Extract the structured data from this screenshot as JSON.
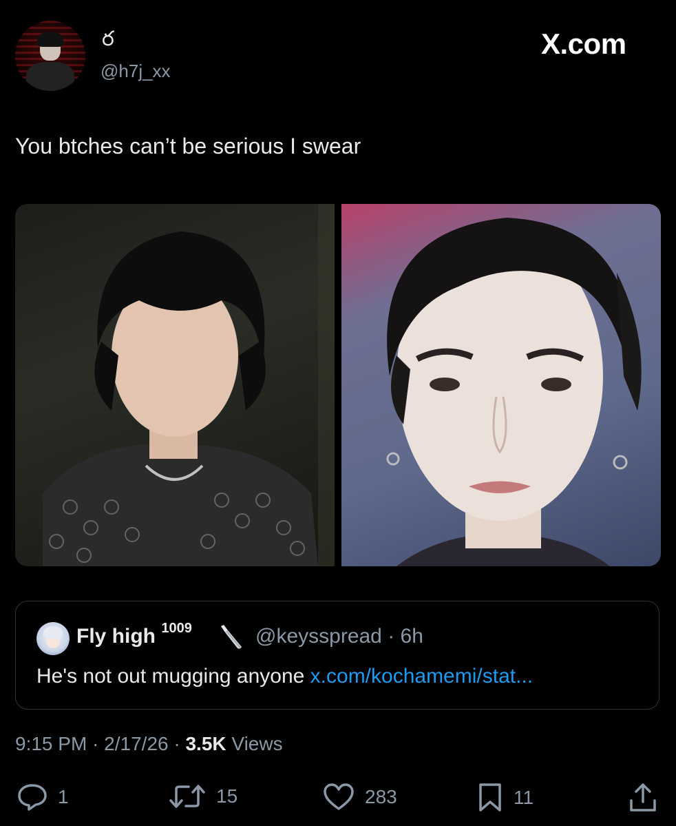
{
  "author": {
    "display_name": "ర",
    "handle": "@h7j_xx"
  },
  "brand": "X.com",
  "tweet": {
    "text": "You btches can’t be serious I swear"
  },
  "quote": {
    "name": "Fly high",
    "name_suffix": "1009",
    "emoji_icon": "knife-icon",
    "handle_time": "@keysspread · 6h",
    "text": "He's not out mugging anyone ",
    "link": "x.com/kochamemi/stat..."
  },
  "meta": {
    "time": "9:15 PM",
    "sep1": " · ",
    "date": "2/17/26",
    "sep2": " · ",
    "views_count": "3.5K",
    "views_label": " Views"
  },
  "actions": {
    "replies": "1",
    "reposts": "15",
    "likes": "283",
    "bookmarks": "11"
  },
  "colors": {
    "background": "#000000",
    "text": "#e7e9ea",
    "secondary": "#8b98a5",
    "link": "#1d9bf0",
    "border": "#2f3336"
  }
}
